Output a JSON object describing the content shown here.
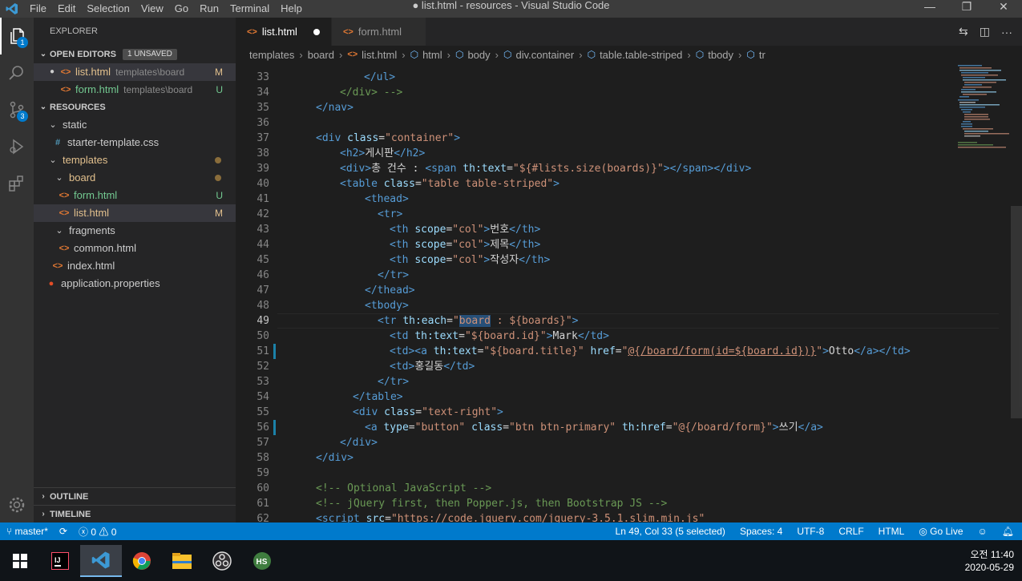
{
  "window": {
    "title": "● list.html - resources - Visual Studio Code",
    "menu": [
      "File",
      "Edit",
      "Selection",
      "View",
      "Go",
      "Run",
      "Terminal",
      "Help"
    ]
  },
  "activity": {
    "explorer_badge": "1",
    "scm_badge": "3"
  },
  "sidebar": {
    "title": "EXPLORER",
    "open_editors": {
      "label": "OPEN EDITORS",
      "badge": "1 UNSAVED",
      "items": [
        {
          "name": "list.html",
          "desc": "templates\\board",
          "status": "M"
        },
        {
          "name": "form.html",
          "desc": "templates\\board",
          "status": "U"
        }
      ]
    },
    "resources": {
      "label": "RESOURCES",
      "tree": {
        "static": "static",
        "css": "starter-template.css",
        "templates": "templates",
        "board": "board",
        "form": "form.html",
        "form_status": "U",
        "list": "list.html",
        "list_status": "M",
        "fragments": "fragments",
        "common": "common.html",
        "index": "index.html",
        "props": "application.properties"
      }
    },
    "outline": "OUTLINE",
    "timeline": "TIMELINE"
  },
  "tabs": [
    {
      "label": "list.html"
    },
    {
      "label": "form.html"
    }
  ],
  "breadcrumb": [
    "templates",
    "board",
    "list.html",
    "html",
    "body",
    "div.container",
    "table.table-striped",
    "tbody",
    "tr"
  ],
  "editor": {
    "line_numbers": [
      "33",
      "34",
      "35",
      "36",
      "37",
      "38",
      "39",
      "40",
      "41",
      "42",
      "43",
      "44",
      "45",
      "46",
      "47",
      "48",
      "49",
      "50",
      "51",
      "52",
      "53",
      "54",
      "55",
      "56",
      "57",
      "58",
      "59",
      "60",
      "61",
      "62"
    ],
    "lines": {
      "l33": "</ul>",
      "l34": "</div> -->",
      "l35": "</nav>",
      "l39_text": "총 건수 : ",
      "l39_attr_val": "\"${#lists.size(boards)}\"",
      "l38_text": "게시판",
      "l43_text": "번호",
      "l44_text": "제목",
      "l45_text": "작성자",
      "l49_sel": "board",
      "l49_rest": " : ${boards}\"",
      "l50_val": "\"${board.id}\"",
      "l50_text": "Mark",
      "l51_title": "\"${board.title}\"",
      "l51_href": "@{/board/form(id=${board.id})}",
      "l51_text": "Otto",
      "l52_text": "홍길동",
      "l56_href": "\"@{/board/form}\"",
      "l56_text": "쓰기",
      "l60": "<!-- Optional JavaScript -->",
      "l61": "<!-- jQuery first, then Popper.js, then Bootstrap JS -->",
      "l62_src": "\"https://code.jquery.com/jquery-3.5.1.slim.min.js\""
    }
  },
  "status": {
    "branch": "master*",
    "errors": "0",
    "warnings": "0",
    "position": "Ln 49, Col 33 (5 selected)",
    "spaces": "Spaces: 4",
    "encoding": "UTF-8",
    "eol": "CRLF",
    "language": "HTML",
    "golive": "Go Live"
  },
  "taskbar": {
    "time": "오전 11:40",
    "date": "2020-05-29"
  },
  "colors": {
    "accent": "#007acc",
    "activity": "#333333",
    "sidebar": "#252526",
    "editor": "#1e1e1e"
  }
}
